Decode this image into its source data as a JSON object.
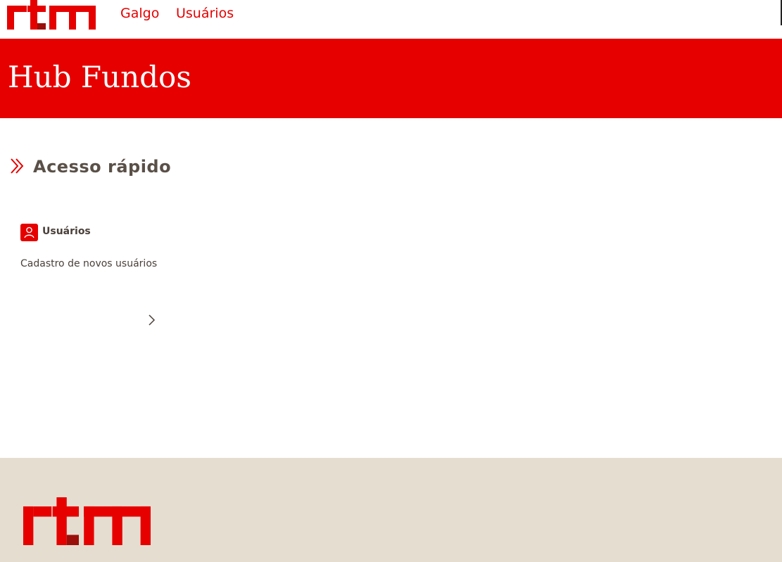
{
  "header": {
    "logo_text": "rtm",
    "nav": [
      {
        "label": "Galgo"
      },
      {
        "label": "Usuários"
      }
    ]
  },
  "banner": {
    "title": "Hub Fundos"
  },
  "quick_access": {
    "title": "Acesso rápido",
    "cards": [
      {
        "title": "Usuários",
        "description": "Cadastro de novos usuários",
        "icon": "user-icon"
      }
    ]
  },
  "footer": {
    "logo_text": "rtm"
  },
  "colors": {
    "brand_red": "#e60000",
    "brand_dark_red": "#9b0f0a",
    "footer_bg": "#e5ddd0",
    "heading_text": "#5a5048"
  }
}
